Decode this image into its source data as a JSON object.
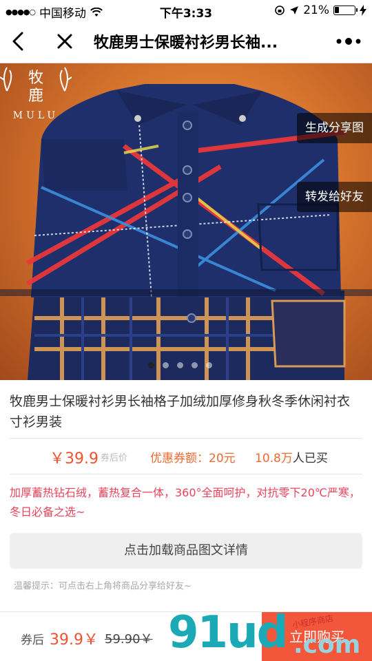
{
  "status_bar": {
    "carrier": "中国移动",
    "time": "下午3:33",
    "battery": "21%"
  },
  "nav": {
    "title": "牧鹿男士保暖衬衫男长袖..."
  },
  "hero": {
    "brand_cn_top": "牧",
    "brand_cn_bottom": "鹿",
    "brand_en": "MULU",
    "share_image_button": "生成分享图",
    "forward_button": "转发给好友",
    "carousel": {
      "count": 5,
      "active_index": 0
    }
  },
  "product": {
    "title": "牧鹿男士保暖衬衫男长袖格子加绒加厚修身秋冬季休闲衬衣寸衫男装",
    "price": "￥39.9",
    "price_label": "券后价",
    "coupon_label": "优惠券额：",
    "coupon_value": "20元",
    "sold_count": "10.8万",
    "sold_suffix": "人已买",
    "promo": "加厚蓄热钻石绒，蓄热复合一体，360°全面呵护，对抗零下20℃严寒，冬日必备之选~",
    "detail_button": "点击加载商品图文详情",
    "tip": "温馨提示：可点击右上角将商品分享给好友~"
  },
  "bottom": {
    "after_label": "券后",
    "after_price": "39.9￥",
    "original_price": "59.90￥",
    "buy_button": "立即购买"
  },
  "watermark": {
    "text": "91ud",
    "domain": ".com",
    "seal": "小程序商店"
  },
  "colors": {
    "accent": "#f0522f",
    "promo": "#e8435c",
    "buy": "#f2573c"
  }
}
